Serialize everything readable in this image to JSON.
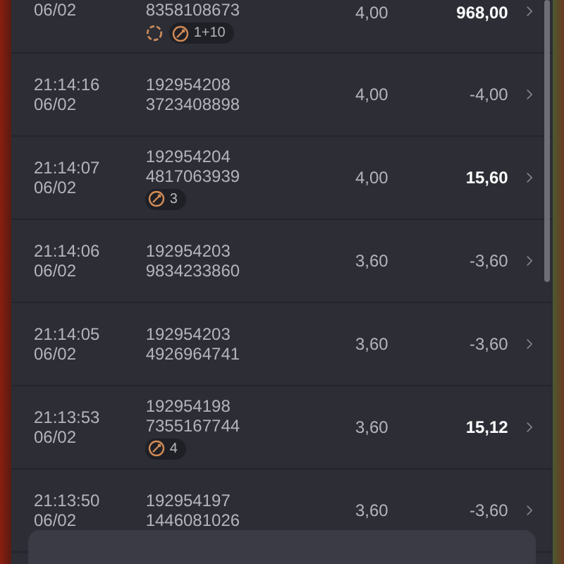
{
  "rows": [
    {
      "date": "06/02",
      "id_line2": "8358108673",
      "badges": [
        {
          "kind": "respin"
        },
        {
          "kind": "bonus",
          "count": "1+10"
        }
      ],
      "stake": "4,00",
      "result": "968,00",
      "won": true
    },
    {
      "time": "21:14:16",
      "date": "06/02",
      "id_line1": "192954208",
      "id_line2": "3723408898",
      "badges": [],
      "stake": "4,00",
      "result": "-4,00",
      "won": false
    },
    {
      "time": "21:14:07",
      "date": "06/02",
      "id_line1": "192954204",
      "id_line2": "4817063939",
      "badges": [
        {
          "kind": "bonus",
          "count": "3"
        }
      ],
      "stake": "4,00",
      "result": "15,60",
      "won": true
    },
    {
      "time": "21:14:06",
      "date": "06/02",
      "id_line1": "192954203",
      "id_line2": "9834233860",
      "badges": [],
      "stake": "3,60",
      "result": "-3,60",
      "won": false
    },
    {
      "time": "21:14:05",
      "date": "06/02",
      "id_line1": "192954203",
      "id_line2": "4926964741",
      "badges": [],
      "stake": "3,60",
      "result": "-3,60",
      "won": false
    },
    {
      "time": "21:13:53",
      "date": "06/02",
      "id_line1": "192954198",
      "id_line2": "7355167744",
      "badges": [
        {
          "kind": "bonus",
          "count": "4"
        }
      ],
      "stake": "3,60",
      "result": "15,12",
      "won": true
    },
    {
      "time": "21:13:50",
      "date": "06/02",
      "id_line1": "192954197",
      "id_line2": "1446081026",
      "badges": [],
      "stake": "3,60",
      "result": "-3,60",
      "won": false
    }
  ]
}
